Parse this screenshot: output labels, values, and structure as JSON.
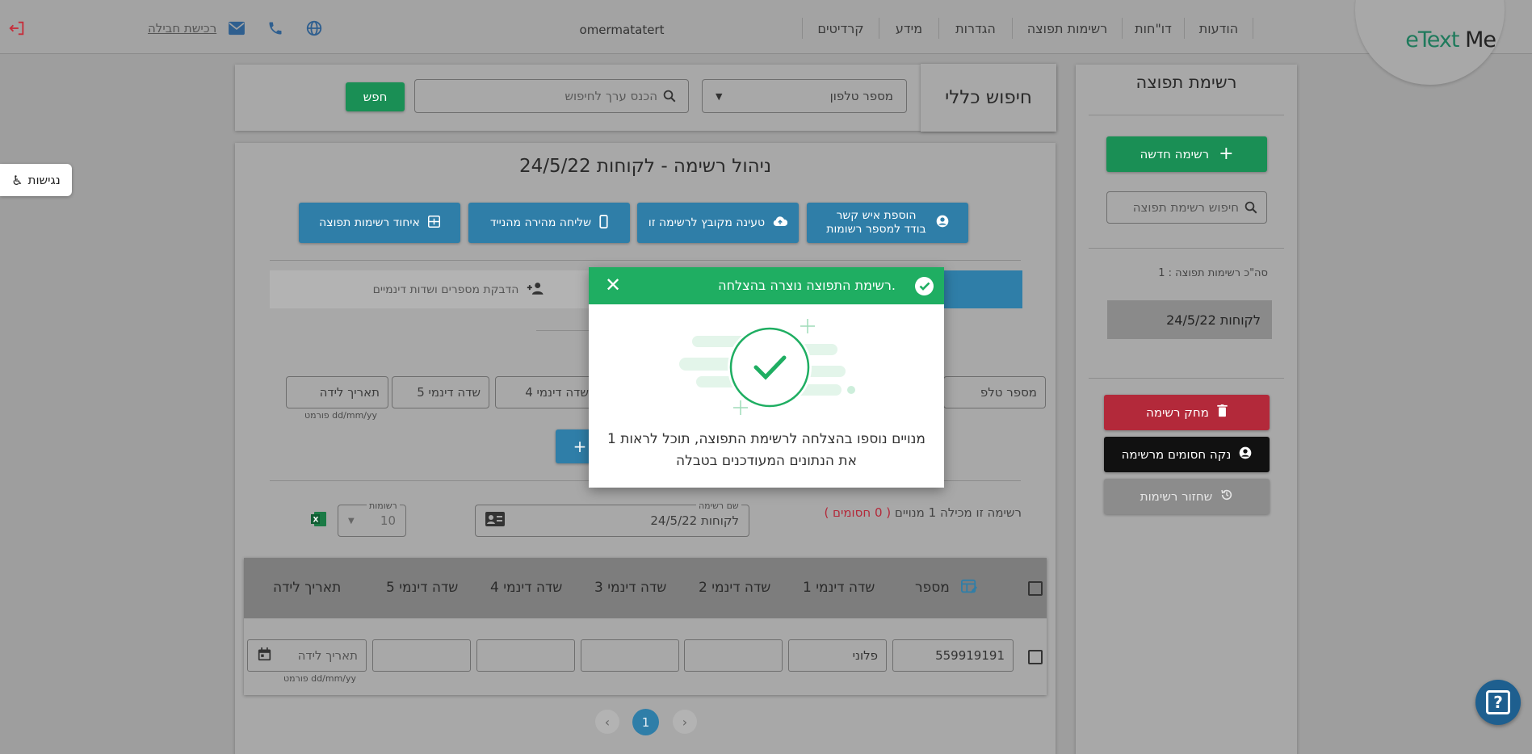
{
  "topbar": {
    "nav": [
      "הודעות",
      "דו\"חות",
      "רשימות תפוצה",
      "הגדרות",
      "מידע",
      "קרדיטים"
    ],
    "username": "omermatatert",
    "quit_link": "רכישת חבילה",
    "logo_e": "e",
    "logo_text": "Text",
    "logo_me": "Me"
  },
  "accessibility": {
    "label": "נגישות"
  },
  "sidebar": {
    "title": "רשימת תפוצה",
    "new_list_button": "רשימה חדשה",
    "search_placeholder": "חיפוש רשימת תפוצה",
    "total_label": "סה\"כ רשימות תפוצה : 1",
    "list_item": "24/5/22 לקוחות",
    "delete_button": "מחק רשימה",
    "clear_blocked_button": "נקה חסומים מרשימה",
    "restore_button": "שחזור רשימות"
  },
  "search": {
    "title": "חיפוש כללי",
    "type_value": "מספר טלפון",
    "input_placeholder": "הכנס ערך לחיפוש",
    "search_button": "חפש"
  },
  "main": {
    "title": "ניהול רשימה - לקוחות 24/5/22",
    "actions": [
      {
        "label": "הוספת איש קשר\nבודד למספר רשומות",
        "line1": "הוספת איש קשר",
        "line2": "בודד למספר רשומות"
      },
      {
        "label": "טעינה מקובץ לרשימה זו"
      },
      {
        "label": "שליחה מהירה מהנייד"
      },
      {
        "label": "איחוד רשימות תפוצה"
      }
    ],
    "paste_tab": "הדבקת מספרים ושדות דינמיים",
    "form_fields": [
      "מספר טלפ",
      "שדה דינמי 4",
      "שדה דינמי 5",
      "תאריך לידה"
    ],
    "date_format": "פורמט dd/mm/yy",
    "list_info": "רשימה זו מכילה 1 מנויים",
    "blocked": "( 0 חסומים )",
    "list_name_label": "שם רשימה",
    "list_name_value": "לקוחות 24/5/22",
    "rows_label": "רשומות",
    "rows_value": "10"
  },
  "table": {
    "headers": [
      "מספר",
      "שדה דינמי 1",
      "שדה דינמי 2",
      "שדה דינמי 3",
      "שדה דינמי 4",
      "שדה דינמי 5",
      "תאריך לידה"
    ],
    "row": {
      "phone": "559919191",
      "field1": "פלוני",
      "date_placeholder": "תאריך לידה",
      "date_format": "פורמט dd/mm/yy"
    },
    "page": "1"
  },
  "modal": {
    "title": "רשימת התפוצה נוצרה בהצלחה.",
    "message": "1 מנויים נוספו בהצלחה לרשימת התפוצה, תוכל לראות את הנתונים המעודכנים בטבלה"
  },
  "colors": {
    "green": "#1fae62",
    "blue": "#3b8fc4",
    "red": "#c62d3a",
    "black": "#111111"
  }
}
